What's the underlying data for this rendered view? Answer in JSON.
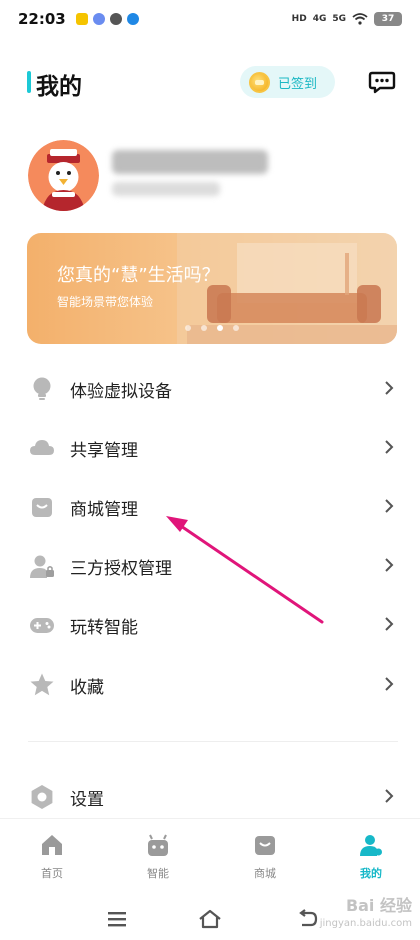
{
  "status_bar": {
    "time": "22:03",
    "indicators": [
      "HD",
      "4G",
      "5G"
    ],
    "battery": "37"
  },
  "header": {
    "title": "我的",
    "checkin_label": "已签到"
  },
  "banner": {
    "title": "您真的“慧”生活吗？",
    "subtitle": "智能场景带您体验",
    "page_count": 4,
    "active_page": 3
  },
  "menu": {
    "items": [
      {
        "label": "体验虚拟设备",
        "icon": "lightbulb-icon"
      },
      {
        "label": "共享管理",
        "icon": "cloud-icon"
      },
      {
        "label": "商城管理",
        "icon": "shopping-bag-icon"
      },
      {
        "label": "三方授权管理",
        "icon": "user-auth-icon"
      },
      {
        "label": "玩转智能",
        "icon": "gamepad-icon"
      },
      {
        "label": "收藏",
        "icon": "star-icon"
      },
      {
        "label": "设置",
        "icon": "hexagon-settings-icon"
      }
    ]
  },
  "bottom_nav": {
    "items": [
      {
        "label": "首页",
        "icon": "home-icon"
      },
      {
        "label": "智能",
        "icon": "robot-icon"
      },
      {
        "label": "商城",
        "icon": "shop-bag-icon"
      },
      {
        "label": "我的",
        "icon": "user-icon"
      }
    ],
    "active_index": 3
  },
  "watermark": {
    "brand": "Bai 经验",
    "sub": "jingyan.baidu.com"
  },
  "colors": {
    "accent": "#17b8c8",
    "icon_gray": "#b8b8b8",
    "annotation_arrow": "#e0157a"
  }
}
